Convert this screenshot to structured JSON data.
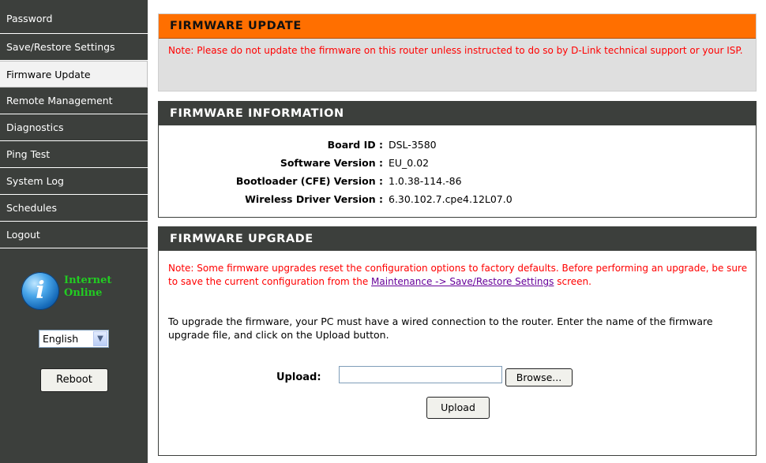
{
  "sidebar": {
    "items": [
      {
        "label": "Password"
      },
      {
        "label": "Save/Restore Settings"
      },
      {
        "label": "Firmware Update"
      },
      {
        "label": "Remote Management"
      },
      {
        "label": "Diagnostics"
      },
      {
        "label": "Ping Test"
      },
      {
        "label": "System Log"
      },
      {
        "label": "Schedules"
      },
      {
        "label": "Logout"
      }
    ],
    "status_line1": "Internet",
    "status_line2": "Online",
    "language": "English",
    "reboot_label": "Reboot"
  },
  "firmware_update": {
    "title": "FIRMWARE UPDATE",
    "note": "Note: Please do not update the firmware on this router unless instructed to do so by D-Link technical support or your ISP."
  },
  "firmware_info": {
    "title": "FIRMWARE INFORMATION",
    "rows": [
      {
        "label": "Board ID :",
        "value": "DSL-3580"
      },
      {
        "label": "Software Version :",
        "value": "EU_0.02"
      },
      {
        "label": "Bootloader (CFE) Version :",
        "value": "1.0.38-114.-86"
      },
      {
        "label": "Wireless Driver Version :",
        "value": "6.30.102.7.cpe4.12L07.0"
      }
    ]
  },
  "firmware_upgrade": {
    "title": "FIRMWARE UPGRADE",
    "note_prefix": "Note: Some firmware upgrades reset the configuration options to factory defaults. Before performing an upgrade, be sure to save the current configuration from the ",
    "note_link": "Maintenance -> Save/Restore Settings",
    "note_suffix": " screen.",
    "instructions": "To upgrade the firmware, your PC must have a wired connection to the router. Enter the name of the firmware upgrade file, and click on the Upload button.",
    "upload_label": "Upload:",
    "file_value": "",
    "browse_label": "Browse...",
    "upload_button": "Upload"
  },
  "colors": {
    "sidebar_bg": "#3c3f3c",
    "orange_header": "#ff6f00",
    "note_red": "#ff0000",
    "status_green": "#22cc22"
  }
}
